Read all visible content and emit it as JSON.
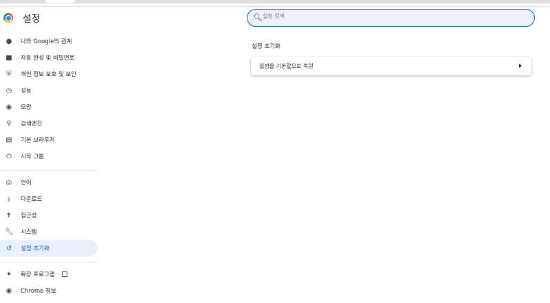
{
  "header": {
    "title": "설정"
  },
  "search": {
    "placeholder": "설정 검색"
  },
  "sidebar": {
    "items": [
      {
        "label": "나와 Google의 관계",
        "icon": "person-icon"
      },
      {
        "label": "자동 완성 및 비밀번호",
        "icon": "clipboard-icon"
      },
      {
        "label": "개인 정보 보호 및 보안",
        "icon": "shield-icon"
      },
      {
        "label": "성능",
        "icon": "speedometer-icon"
      },
      {
        "label": "모양",
        "icon": "palette-icon"
      },
      {
        "label": "검색엔진",
        "icon": "search-icon"
      },
      {
        "label": "기본 브라우저",
        "icon": "browser-icon"
      },
      {
        "label": "시작 그룹",
        "icon": "power-icon"
      },
      {
        "label": "언어",
        "icon": "globe-icon"
      },
      {
        "label": "다운로드",
        "icon": "download-icon"
      },
      {
        "label": "접근성",
        "icon": "accessibility-icon"
      },
      {
        "label": "시스템",
        "icon": "wrench-icon"
      },
      {
        "label": "설정 초기화",
        "icon": "restore-icon",
        "selected": true
      },
      {
        "label": "확장 프로그램",
        "icon": "puzzle-icon"
      },
      {
        "label": "Chrome 정보",
        "icon": "chrome-icon"
      }
    ]
  },
  "main": {
    "section_title": "설정 초기화",
    "reset_row": "설정을 기본값으로 복원"
  },
  "colors": {
    "accent": "#0b57d0",
    "selected_bg": "#e8f0fe"
  }
}
